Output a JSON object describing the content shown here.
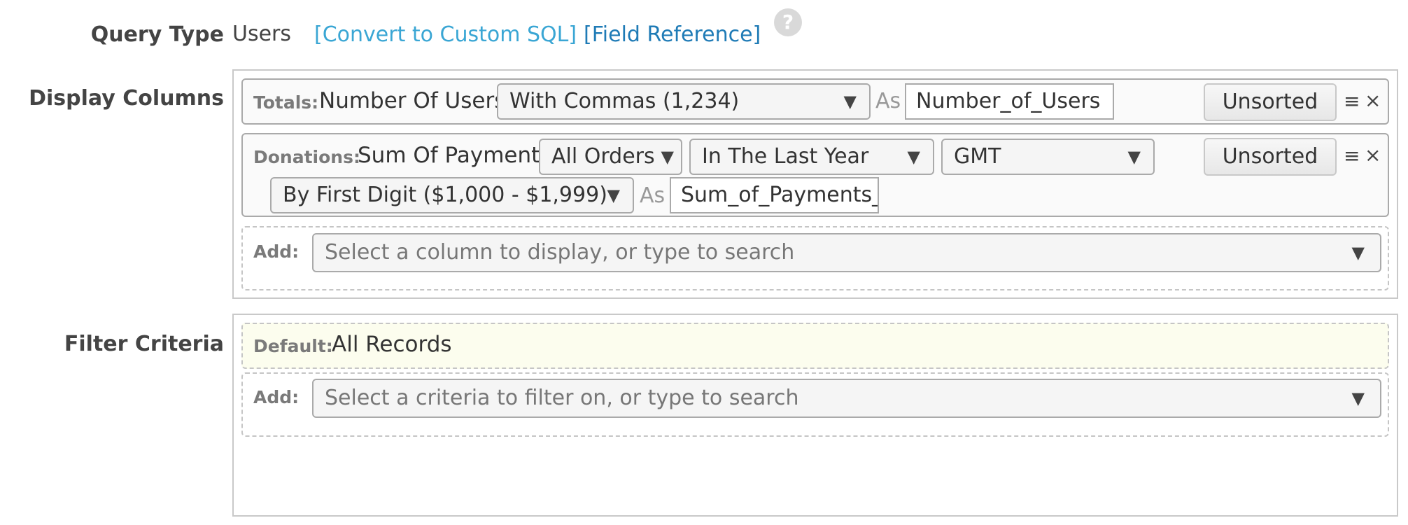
{
  "query_type": {
    "label": "Query Type",
    "value": "Users",
    "convert_link": "[Convert to Custom SQL]",
    "field_reference_link": "[Field Reference]",
    "help_glyph": "?"
  },
  "display_columns": {
    "label": "Display Columns",
    "rows": [
      {
        "tag": "Totals:",
        "field": "Number Of Users",
        "format_select": "With Commas (1,234)",
        "as_label": "As",
        "alias": "Number_of_Users",
        "sort_button": "Unsorted"
      },
      {
        "tag": "Donations:",
        "field": "Sum Of Payments",
        "orders_select": "All Orders",
        "period_select": "In The Last Year",
        "timezone_select": "GMT",
        "grouping_select": "By First Digit ($1,000 - $1,999)",
        "as_label": "As",
        "alias": "Sum_of_Payments_",
        "sort_button": "Unsorted"
      }
    ],
    "add": {
      "label": "Add:",
      "placeholder": "Select a column to display, or type to search"
    }
  },
  "filter_criteria": {
    "label": "Filter Criteria",
    "default_tag": "Default:",
    "default_value": "All Records",
    "add": {
      "label": "Add:",
      "placeholder": "Select a criteria to filter on, or type to search"
    }
  },
  "icons": {
    "drag_glyph": "≡",
    "remove_glyph": "×",
    "dropdown_glyph": "▼"
  }
}
